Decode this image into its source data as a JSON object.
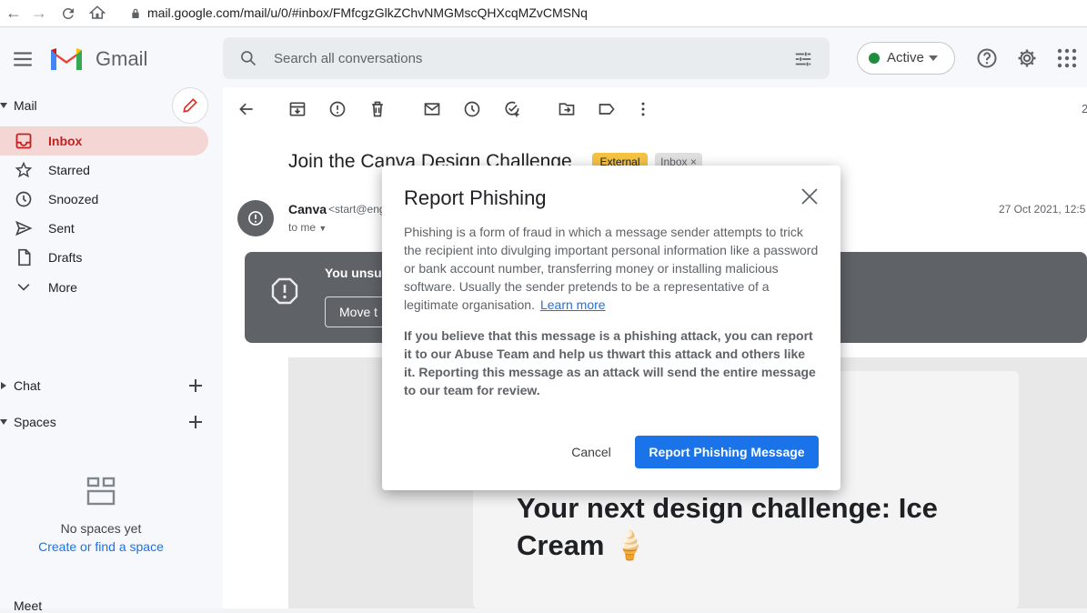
{
  "browser": {
    "url": "mail.google.com/mail/u/0/#inbox/FMfcgzGlkZChvNMGMscQHXcqMZvCMSNq"
  },
  "header": {
    "app_name": "Gmail",
    "search_placeholder": "Search all conversations",
    "status_label": "Active"
  },
  "sidebar": {
    "mail_section": "Mail",
    "items": [
      {
        "label": "Inbox",
        "icon": "inbox-icon",
        "selected": true
      },
      {
        "label": "Starred",
        "icon": "star-icon"
      },
      {
        "label": "Snoozed",
        "icon": "clock-icon"
      },
      {
        "label": "Sent",
        "icon": "send-icon"
      },
      {
        "label": "Drafts",
        "icon": "draft-icon"
      },
      {
        "label": "More",
        "icon": "chevron-down-icon"
      }
    ],
    "chat_section": "Chat",
    "spaces_section": "Spaces",
    "no_spaces_text": "No spaces yet",
    "create_space_link": "Create or find a space",
    "meet_section": "Meet"
  },
  "toolbar": {
    "page_count_fragment": "2"
  },
  "email": {
    "subject": "Join the Canva Design Challenge",
    "tag_external": "External",
    "tag_inbox": "Inbox",
    "tag_inbox_close": "×",
    "sender_name": "Canva",
    "sender_email": "<start@eng",
    "recipient": "to me",
    "date": "27 Oct 2021, 12:5",
    "warning_text": "You unsub",
    "move_button": "Move t",
    "headline": "Your next design challenge: Ice Cream 🍦"
  },
  "dialog": {
    "title": "Report Phishing",
    "paragraph1": "Phishing is a form of fraud in which a message sender attempts to trick the recipient into divulging important personal information like a password or bank account number, transferring money or installing malicious software. Usually the sender pretends to be a representative of a legitimate organisation.",
    "learn_more": "Learn more",
    "paragraph2": "If you believe that this message is a phishing attack, you can report it to our Abuse Team and help us thwart this attack and others like it. Reporting this message as an attack will send the entire message to our team for review.",
    "cancel_label": "Cancel",
    "report_label": "Report Phishing Message"
  },
  "colors": {
    "accent": "#1a73e8",
    "inbox_highlight": "#f4d6d5",
    "external_tag": "#f6c343",
    "active_dot": "#1e8e3e"
  }
}
